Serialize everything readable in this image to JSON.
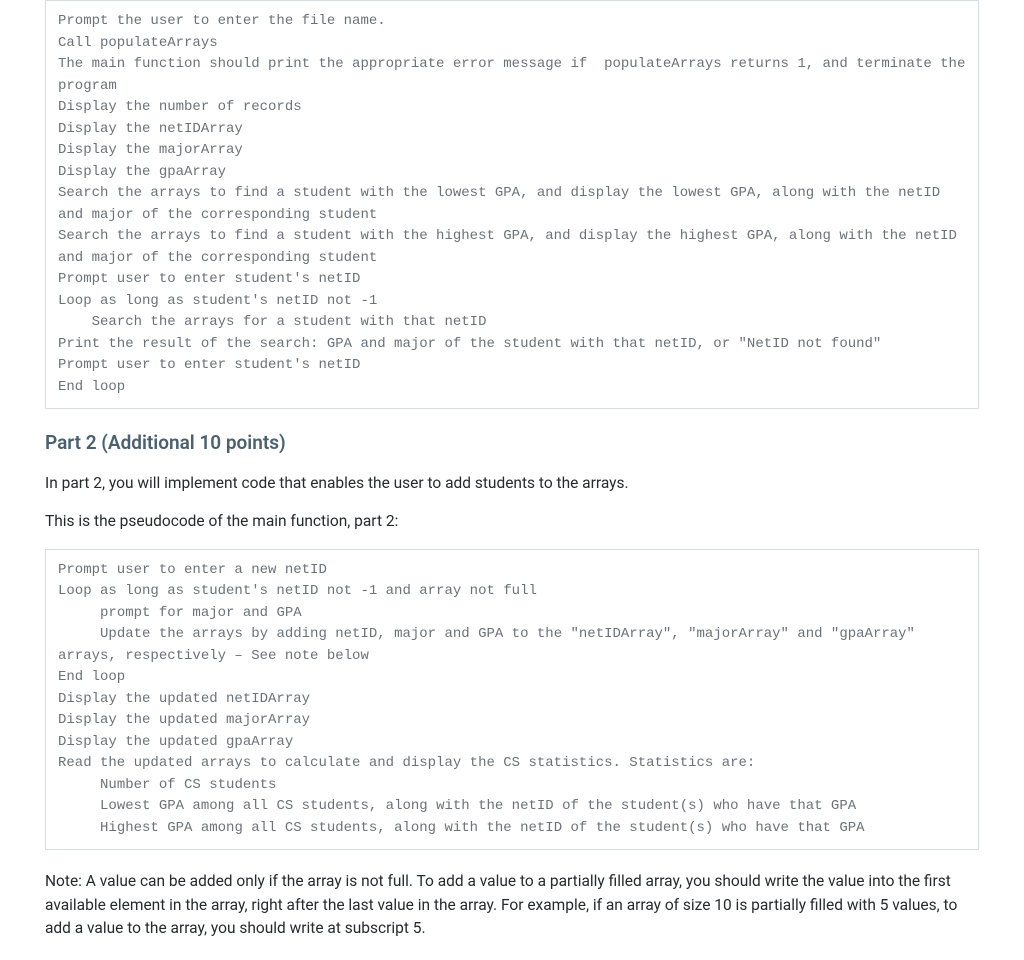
{
  "codeBlock1": "Prompt the user to enter the file name.\nCall populateArrays\nThe main function should print the appropriate error message if  populateArrays returns 1, and terminate the program\nDisplay the number of records\nDisplay the netIDArray\nDisplay the majorArray\nDisplay the gpaArray\nSearch the arrays to find a student with the lowest GPA, and display the lowest GPA, along with the netID and major of the corresponding student\nSearch the arrays to find a student with the highest GPA, and display the highest GPA, along with the netID and major of the corresponding student\nPrompt user to enter student's netID\nLoop as long as student's netID not -1\n    Search the arrays for a student with that netID\nPrint the result of the search: GPA and major of the student with that netID, or \"NetID not found\"\nPrompt user to enter student's netID\nEnd loop",
  "heading": "Part 2 (Additional 10 points)",
  "intro1": "In part 2, you will implement code that enables the user to add students to the arrays.",
  "intro2": "This is the pseudocode of the main function, part 2:",
  "codeBlock2": "Prompt user to enter a new netID\nLoop as long as student's netID not -1 and array not full\n     prompt for major and GPA\n     Update the arrays by adding netID, major and GPA to the \"netIDArray\", \"majorArray\" and \"gpaArray\" arrays, respectively – See note below\nEnd loop\nDisplay the updated netIDArray\nDisplay the updated majorArray\nDisplay the updated gpaArray\nRead the updated arrays to calculate and display the CS statistics. Statistics are:\n     Number of CS students\n     Lowest GPA among all CS students, along with the netID of the student(s) who have that GPA\n     Highest GPA among all CS students, along with the netID of the student(s) who have that GPA",
  "note": "Note: A value can be added only if the array is not full. To add a value to a partially filled array, you should write the value into the first available element in the array, right after the last value in the array. For example, if an array of size 10 is partially filled with 5 values, to add a value to the array, you should write at subscript 5."
}
